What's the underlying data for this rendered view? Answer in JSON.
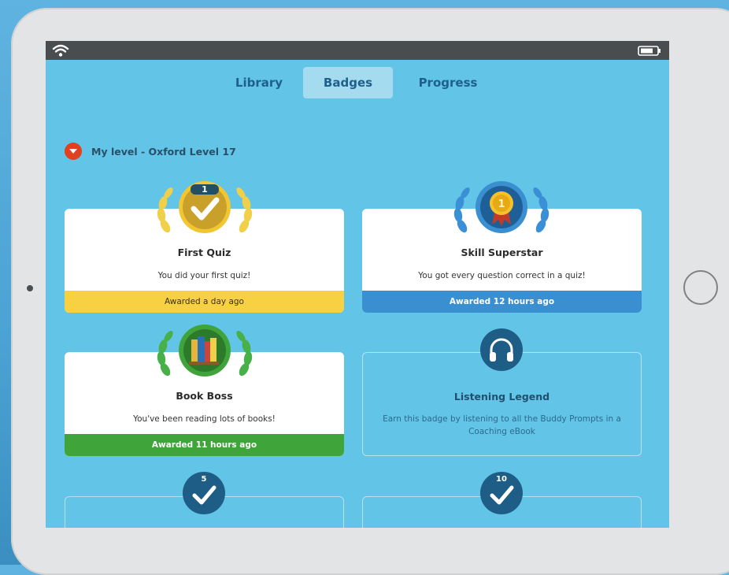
{
  "tabs": [
    {
      "label": "Library",
      "active": false
    },
    {
      "label": "Badges",
      "active": true
    },
    {
      "label": "Progress",
      "active": false
    }
  ],
  "level": {
    "label": "My level - Oxford Level 17"
  },
  "badges": [
    {
      "title": "First Quiz",
      "description": "You did your first quiz!",
      "awarded": "Awarded a day ago",
      "badge_number": "1",
      "icon": "checkmark-medal-icon",
      "color": "#f8d143"
    },
    {
      "title": "Skill Superstar",
      "description": "You got every question correct in a quiz!",
      "awarded": "Awarded 12 hours ago",
      "badge_number": "1",
      "icon": "gold-medal-icon",
      "color": "#3a8fd0"
    },
    {
      "title": "Book Boss",
      "description": "You've been reading lots of books!",
      "awarded": "Awarded 11 hours ago",
      "icon": "books-icon",
      "color": "#3fa43a"
    },
    {
      "title": "Listening Legend",
      "description": "Earn this badge by listening to all the Buddy Prompts in a Coaching eBook",
      "icon": "headphones-icon"
    },
    {
      "badge_number": "5",
      "icon": "checkmark-badge-icon"
    },
    {
      "badge_number": "10",
      "icon": "checkmark-badge-icon"
    }
  ],
  "colors": {
    "screen_bg": "#62c4e6",
    "accent_level": "#e0421f",
    "status_bar": "#4a4d50"
  }
}
